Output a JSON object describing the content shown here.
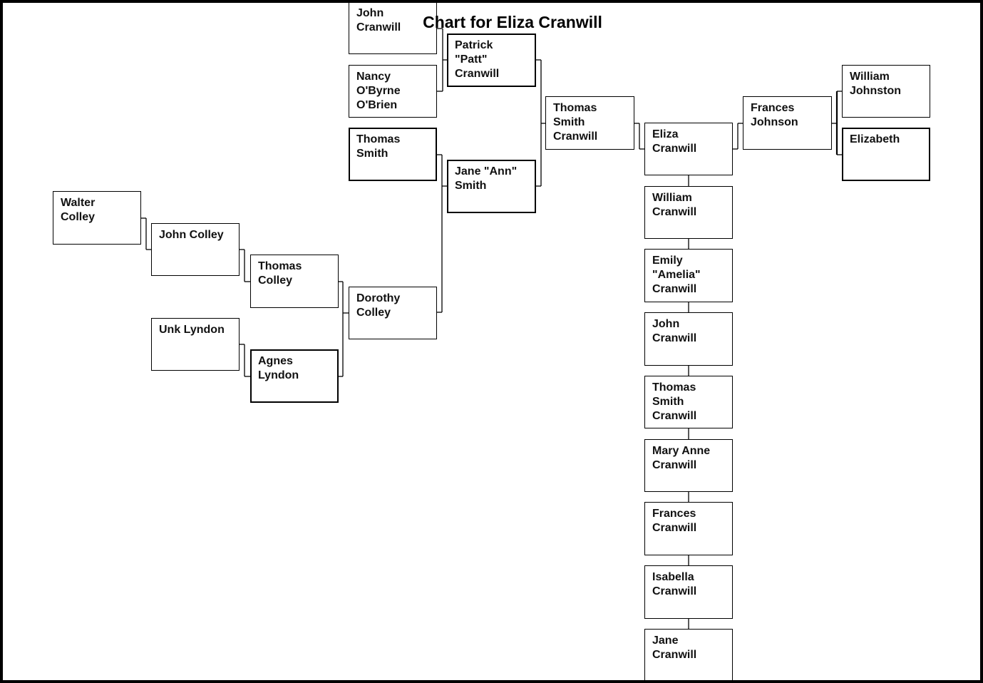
{
  "chart_title": "Chart for Eliza Cranwill",
  "people": {
    "john_cranwill_sr": "John\nCranwill",
    "nancy_obyrne": "Nancy\nO'Byrne\nO'Brien",
    "thomas_smith": "Thomas\nSmith",
    "patrick_cranwill": "Patrick\n\"Patt\"\nCranwill",
    "jane_ann_smith": "Jane \"Ann\"\nSmith",
    "thomas_smith_cranwill_father": "Thomas\nSmith\nCranwill",
    "walter_colley": "Walter\nColley",
    "john_colley": "John Colley",
    "thomas_colley": "Thomas\nColley",
    "unk_lyndon": "Unk Lyndon",
    "agnes_lyndon": "Agnes\nLyndon",
    "dorothy_colley": "Dorothy\nColley",
    "eliza_cranwill": "Eliza\nCranwill",
    "frances_johnson": "Frances\nJohnson",
    "william_johnston": "William\nJohnston",
    "elizabeth": "Elizabeth"
  },
  "siblings": [
    "William\nCranwill",
    "Emily\n\"Amelia\"\nCranwill",
    "John\nCranwill",
    "Thomas\nSmith\nCranwill",
    "Mary Anne\nCranwill",
    "Frances\nCranwill",
    "Isabella\nCranwill",
    "Jane\nCranwill"
  ]
}
